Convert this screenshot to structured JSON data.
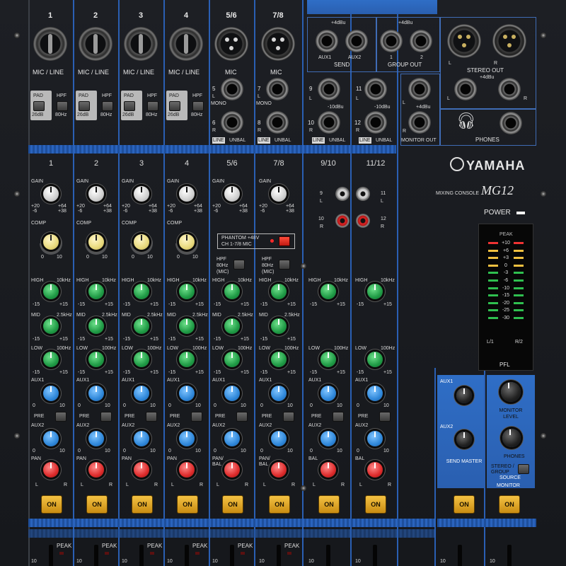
{
  "brand": {
    "name": "YAMAHA",
    "model_label": "MIXING CONSOLE",
    "model": "MG12"
  },
  "inputs": {
    "channels": [
      {
        "num": "1",
        "label": "MIC / LINE"
      },
      {
        "num": "2",
        "label": "MIC / LINE"
      },
      {
        "num": "3",
        "label": "MIC / LINE"
      },
      {
        "num": "4",
        "label": "MIC / LINE"
      },
      {
        "num": "5/6",
        "label": "MIC"
      },
      {
        "num": "7/8",
        "label": "MIC"
      }
    ],
    "pad": {
      "label": "PAD",
      "value": "26dB"
    },
    "hpf": {
      "label": "HPF",
      "value": "80Hz"
    },
    "stereo_ins": {
      "ch56": {
        "l": "5",
        "l_sub": "L",
        "mono": "MONO",
        "r": "6",
        "r_sub": "R"
      },
      "ch78": {
        "l": "7",
        "l_sub": "L",
        "mono": "MONO",
        "r": "8",
        "r_sub": "R"
      },
      "ch910": {
        "top": "9",
        "top_sub": "L",
        "bot": "10",
        "bot_sub": "R",
        "level": "-10dBu"
      },
      "ch1112": {
        "top": "11",
        "top_sub": "L",
        "bot": "12",
        "bot_sub": "R",
        "level": "-10dBu"
      },
      "line": "LINE",
      "unbal": "UNBAL"
    }
  },
  "outputs": {
    "send": {
      "level": "+4dBu",
      "aux1": "AUX1",
      "aux2": "AUX2",
      "label": "SEND"
    },
    "group": {
      "level": "+4dBu",
      "one": "1",
      "two": "2",
      "label": "GROUP OUT"
    },
    "stereo": {
      "l": "L",
      "r": "R",
      "label": "STEREO OUT",
      "level": "+4dBu"
    },
    "monitor": {
      "level": "+4dBu",
      "l": "L",
      "r": "R",
      "label": "MONITOR OUT"
    },
    "phones": {
      "label": "PHONES"
    }
  },
  "strips": [
    {
      "num": "1",
      "type": "mono"
    },
    {
      "num": "2",
      "type": "mono"
    },
    {
      "num": "3",
      "type": "mono"
    },
    {
      "num": "4",
      "type": "mono"
    },
    {
      "num": "5/6",
      "type": "stereo-mic"
    },
    {
      "num": "7/8",
      "type": "stereo-mic"
    },
    {
      "num": "9/10",
      "type": "stereo"
    },
    {
      "num": "11/12",
      "type": "stereo"
    }
  ],
  "controls": {
    "gain": "GAIN",
    "gain_min": "+20",
    "gain_min2": "-6",
    "gain_max": "+64",
    "gain_max2": "+38",
    "comp": "COMP",
    "comp_min": "0",
    "comp_max": "10",
    "high": "HIGH",
    "high_freq": "10kHz",
    "mid": "MID",
    "mid_freq": "2.5kHz",
    "low": "LOW",
    "low_freq": "100Hz",
    "eq_min": "-15",
    "eq_max": "+15",
    "aux1": "AUX1",
    "aux2": "AUX2",
    "pre": "PRE",
    "pan": "PAN",
    "pan_bal": "PAN/ BAL",
    "bal": "BAL",
    "pan_l": "L",
    "pan_r": "R",
    "on": "ON",
    "peak": "PEAK",
    "fader_10": "10",
    "knob_min": "0",
    "knob_max": "10"
  },
  "phantom": {
    "label": "PHANTOM +48V",
    "sub": "CH 1-7/8 MIC"
  },
  "hpf_mic": {
    "label": "HPF 80Hz (MIC)"
  },
  "rca": {
    "top_l": "9",
    "top_r": "11",
    "bot_l": "10",
    "bot_r": "12",
    "l": "L",
    "r": "R"
  },
  "power": {
    "label": "POWER"
  },
  "meter": {
    "peak": "PEAK",
    "scale": [
      "+10",
      "+6",
      "+3",
      "0",
      "-3",
      "-6",
      "-10",
      "-15",
      "-20",
      "-25",
      "-30"
    ],
    "left": "L/1",
    "right": "R/2",
    "pfl": "PFL"
  },
  "master": {
    "aux1": "AUX1",
    "aux2": "AUX2",
    "send_master": "SEND MASTER",
    "monitor_level": "MONITOR LEVEL",
    "phones": "PHONES",
    "source_options": "STEREO / GROUP",
    "source": "SOURCE",
    "monitor": "MONITOR"
  }
}
